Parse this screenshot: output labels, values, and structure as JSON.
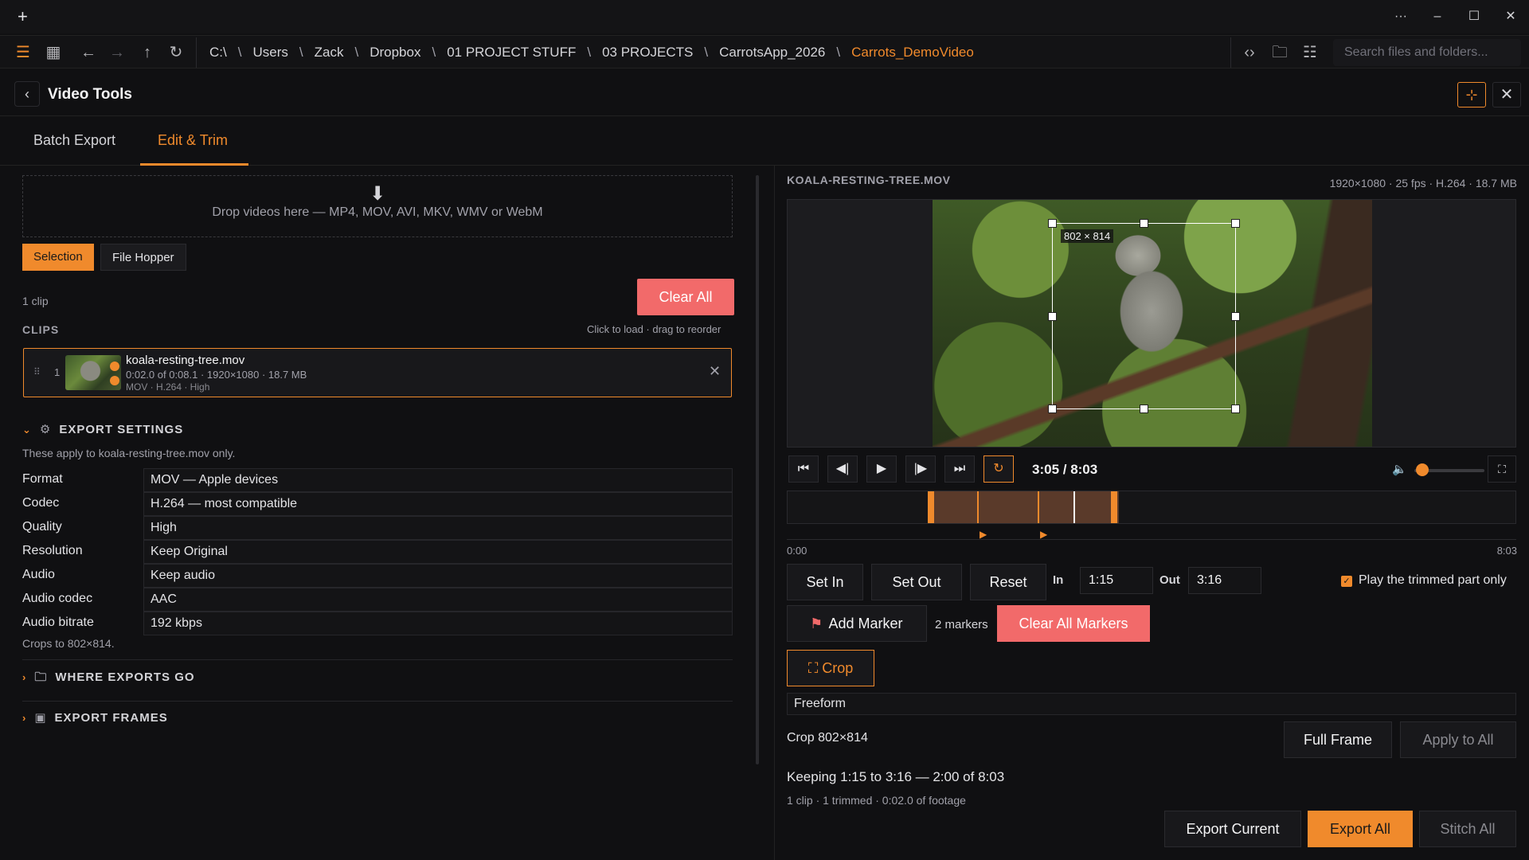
{
  "titlebar": {
    "plus": "+",
    "more": "···",
    "minimize": "–",
    "maximize": "☐",
    "close": "✕"
  },
  "nav": {
    "path": [
      "C:\\",
      "Users",
      "Zack",
      "Dropbox",
      "01 PROJECT STUFF",
      "03 PROJECTS",
      "CarrotsApp_2026",
      "Carrots_DemoVideo"
    ],
    "separator": "\\",
    "search_placeholder": "Search files and folders..."
  },
  "header": {
    "title": "Video Tools"
  },
  "tabs": [
    {
      "label": "Batch Export"
    },
    {
      "label": "Edit & Trim"
    }
  ],
  "left": {
    "dropzone": "Drop videos here — MP4, MOV, AVI, MKV, WMV or WebM",
    "segments": [
      "Selection",
      "File Hopper"
    ],
    "clip_count": "1 clip",
    "clear_all": "Clear All",
    "clips_label": "CLIPS",
    "clips_hint": "Click to load · drag to reorder",
    "clip": {
      "index": "1",
      "name": "koala-resting-tree.mov",
      "meta1": "0:02.0 of 0:08.1 · 1920×1080 · 18.7 MB",
      "meta2": "MOV · H.264 · High"
    },
    "export_settings": {
      "title": "EXPORT SETTINGS",
      "applies": "These apply to koala-resting-tree.mov only.",
      "rows": [
        {
          "label": "Format",
          "value": "MOV — Apple devices"
        },
        {
          "label": "Codec",
          "value": "H.264 — most compatible"
        },
        {
          "label": "Quality",
          "value": "High"
        },
        {
          "label": "Resolution",
          "value": "Keep Original"
        },
        {
          "label": "Audio",
          "value": "Keep audio"
        },
        {
          "label": "Audio codec",
          "value": "AAC"
        },
        {
          "label": "Audio bitrate",
          "value": "192 kbps"
        }
      ],
      "crops_note": "Crops to 802×814."
    },
    "where_exports": "WHERE EXPORTS GO",
    "export_frames": "EXPORT FRAMES"
  },
  "player": {
    "file_name": "KOALA-RESTING-TREE.MOV",
    "file_meta": "1920×1080 · 25 fps · H.264 · 18.7 MB",
    "crop_label": "802 × 814",
    "timecode": "3:05 / 8:03",
    "volume": 0.1,
    "timeline_start": "0:00",
    "timeline_end": "8:03",
    "set_in": "Set In",
    "set_out": "Set Out",
    "reset": "Reset",
    "in_label": "In",
    "in_value": "1:15",
    "out_label": "Out",
    "out_value": "3:16",
    "play_trimmed": "Play the trimmed part only",
    "add_marker": "Add Marker",
    "markers_count": "2 markers",
    "clear_markers": "Clear All Markers",
    "crop_button": "Crop",
    "crop_mode": "Freeform",
    "crop_size": "Crop 802×814",
    "full_frame": "Full Frame",
    "apply_all": "Apply to All",
    "keeping": "Keeping 1:15 to 3:16 — 2:00 of 8:03",
    "summary": "1 clip · 1 trimmed · 0:02.0 of footage",
    "export_current": "Export Current",
    "export_all": "Export All",
    "stitch_all": "Stitch All"
  }
}
